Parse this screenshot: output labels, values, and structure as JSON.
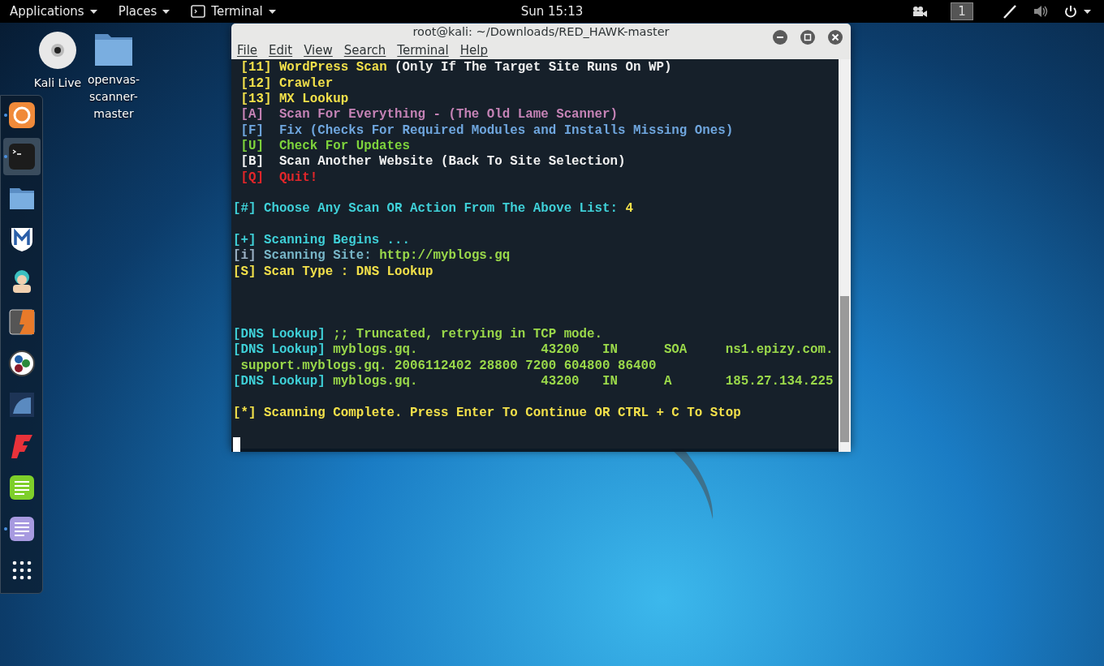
{
  "top_bar": {
    "menus": [
      {
        "label": "Applications"
      },
      {
        "label": "Places"
      },
      {
        "label": "Terminal",
        "icon": true
      }
    ],
    "clock": "Sun 15:13",
    "workspace": "1"
  },
  "desktop_icons": [
    {
      "label": "Kali Live",
      "kind": "disc"
    },
    {
      "label": "openvas-scanner-master",
      "kind": "folder"
    }
  ],
  "dock": [
    {
      "kind": "firefox",
      "running": true,
      "selected": false
    },
    {
      "kind": "terminal",
      "running": true,
      "selected": true
    },
    {
      "kind": "files",
      "running": false,
      "selected": false
    },
    {
      "kind": "metasploit",
      "running": false,
      "selected": false
    },
    {
      "kind": "armitage",
      "running": false,
      "selected": false
    },
    {
      "kind": "burp",
      "running": false,
      "selected": false
    },
    {
      "kind": "maltego",
      "running": false,
      "selected": false
    },
    {
      "kind": "beef",
      "running": false,
      "selected": false
    },
    {
      "kind": "faraday",
      "running": false,
      "selected": false
    },
    {
      "kind": "leafpad",
      "running": false,
      "selected": false
    },
    {
      "kind": "notes",
      "running": true,
      "selected": false
    },
    {
      "kind": "apps",
      "running": false,
      "selected": false
    }
  ],
  "window": {
    "title": "root@kali: ~/Downloads/RED_HAWK-master",
    "menu": [
      "File",
      "Edit",
      "View",
      "Search",
      "Terminal",
      "Help"
    ],
    "blocks": [
      {
        "kind": "normal",
        "lines": [
          [
            {
              "text": " [11] ",
              "color": "#f2e04a"
            },
            {
              "text": "WordPress Scan ",
              "color": "#f2e04a"
            },
            {
              "text": "(Only If The Target Site Runs On WP)",
              "color": "#f0f0f0"
            }
          ],
          [
            {
              "text": " [12] Crawler",
              "color": "#f2e04a"
            }
          ],
          [
            {
              "text": " [13] MX Lookup",
              "color": "#f2e04a"
            }
          ],
          [
            {
              "text": " [A]  Scan For Everything - (The Old Lame Scanner)",
              "color": "#c583b6"
            }
          ],
          [
            {
              "text": " [F]  Fix (Checks For Required Modules and Installs Missing Ones)",
              "color": "#6fa6de"
            }
          ],
          [
            {
              "text": " [U]  Check For Updates",
              "color": "#7ed33c"
            }
          ],
          [
            {
              "text": " [B]  Scan Another Website (Back To Site Selection)",
              "color": "#f0f0f0"
            }
          ],
          [
            {
              "text": " [Q]  Quit!",
              "color": "#e2262a"
            }
          ]
        ]
      },
      {
        "kind": "normal",
        "lines": [
          [
            {
              "text": "[#] Choose Any Scan OR Action From The Above List: ",
              "color": "#3fd0d8"
            },
            {
              "text": "4",
              "color": "#f2e04a"
            }
          ]
        ]
      },
      {
        "kind": "normal",
        "lines": [
          [
            {
              "text": "[+] Scanning Begins ...",
              "color": "#3fd0d8"
            }
          ],
          [
            {
              "text": "[i] ",
              "color": "#9ab0c4"
            },
            {
              "text": "Scanning Site: ",
              "color": "#78b6c8"
            },
            {
              "text": "http://myblogs.gq",
              "color": "#9ad84a"
            }
          ],
          [
            {
              "text": "[S] Scan Type : DNS Lookup",
              "color": "#f2e04a"
            }
          ]
        ]
      },
      {
        "kind": "spaced",
        "lines": [
          [
            {
              "text": "[DNS Lookup] ",
              "color": "#3fd0d8"
            },
            {
              "text": ";; Truncated, retrying in TCP mode.",
              "color": "#9ad84a"
            }
          ],
          [
            {
              "text": "[DNS Lookup] ",
              "color": "#3fd0d8"
            },
            {
              "text": "myblogs.gq.                43200   IN      SOA     ns1.epizy.com.",
              "color": "#9ad84a"
            }
          ],
          [
            {
              "text": " support.myblogs.gq. 2006112402 28800 7200 604800 86400",
              "color": "#9ad84a"
            }
          ],
          [
            {
              "text": "[DNS Lookup] ",
              "color": "#3fd0d8"
            },
            {
              "text": "myblogs.gq.                43200   IN      A       185.27.134.225",
              "color": "#9ad84a"
            }
          ]
        ]
      },
      {
        "kind": "normal",
        "lines": [
          [
            {
              "text": "[*] Scanning Complete. Press Enter To Continue OR CTRL + C To Stop",
              "color": "#f2e04a"
            }
          ]
        ]
      }
    ]
  }
}
